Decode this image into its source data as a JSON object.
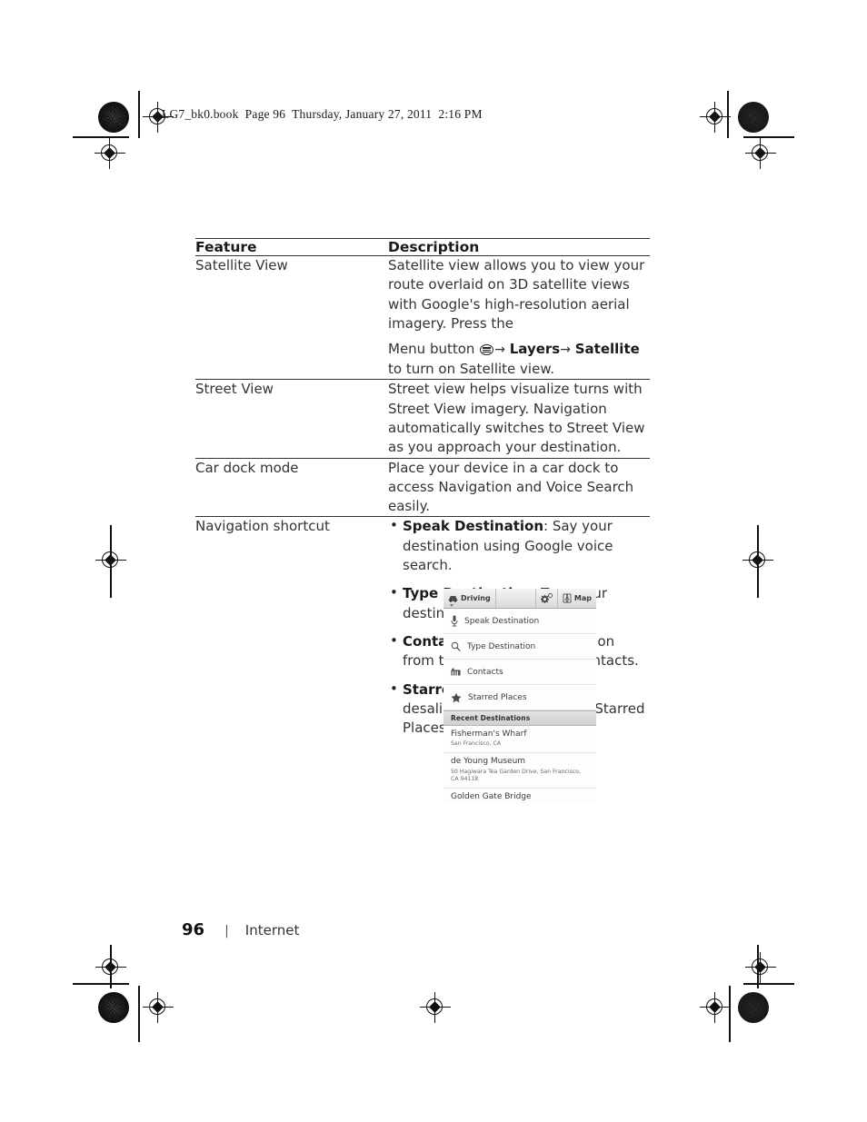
{
  "page_header": "LG7_bk0.book  Page 96  Thursday, January 27, 2011  2:16 PM",
  "table": {
    "headers": {
      "feature": "Feature",
      "description": "Description"
    },
    "rows": [
      {
        "feature": "Satellite View",
        "desc_part1": "Satellite view allows you to view your route overlaid on 3D satellite views with Google's high-resolution aerial imagery. Press the",
        "desc_line2_pre": "Menu button",
        "desc_line2_layers": "Layers",
        "desc_line2_satellite": "Satellite",
        "desc_line2_post": "to turn on Satellite view.",
        "arrow": "→"
      },
      {
        "feature": "Street View",
        "description": "Street view helps visualize turns with Street View imagery. Navigation automatically switches to Street View as you approach your destination."
      },
      {
        "feature": "Car dock mode",
        "description": "Place your device in a car dock to access Navigation and Voice Search easily."
      },
      {
        "feature": "Navigation shortcut",
        "bullets": [
          {
            "term": "Speak Destination",
            "text": ": Say your destination using Google voice search."
          },
          {
            "term": "Type Destination",
            "text": ": Type your destination."
          },
          {
            "term": "Contacts",
            "text": ": Select a destination from the location of your contacts."
          },
          {
            "term": "Starred Places",
            "text": ": Select a desalination from the list of Starred Places."
          }
        ]
      }
    ]
  },
  "phone_screenshot": {
    "toolbar": {
      "driving_label": "Driving",
      "map_label": "Map",
      "settings_icon": "gear-icon",
      "driving_icon": "car-icon",
      "map_icon": "map-book-icon"
    },
    "menu_items": [
      {
        "label": "Speak Destination",
        "icon": "microphone-icon"
      },
      {
        "label": "Type Destination",
        "icon": "search-icon"
      },
      {
        "label": "Contacts",
        "icon": "contacts-icon"
      },
      {
        "label": "Starred Places",
        "icon": "star-icon"
      }
    ],
    "section_title": "Recent Destinations",
    "destinations": [
      {
        "name": "Fisherman's Wharf",
        "address": "San Francisco, CA"
      },
      {
        "name": "de Young Museum",
        "address": "50 Hagiwara Tea Garden Drive, San Francisco, CA 94118"
      },
      {
        "name": "Golden Gate Bridge",
        "address": ""
      }
    ]
  },
  "footer": {
    "page_number": "96",
    "separator": "|",
    "section": "Internet"
  }
}
